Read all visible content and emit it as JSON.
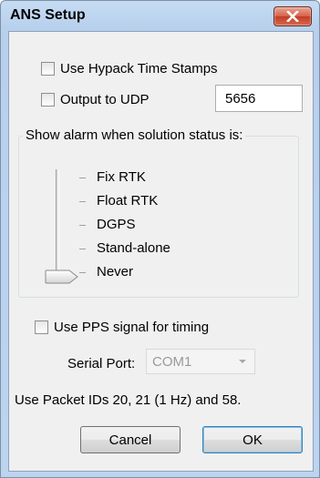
{
  "window": {
    "title": "ANS Setup"
  },
  "options": {
    "use_hypack_timestamps": {
      "label": "Use Hypack Time Stamps",
      "checked": false
    },
    "output_udp": {
      "label": "Output to UDP",
      "checked": false,
      "port": "5656"
    }
  },
  "alarm_group": {
    "label": "Show alarm when solution status is:",
    "levels": [
      "Fix RTK",
      "Float RTK",
      "DGPS",
      "Stand-alone",
      "Never"
    ],
    "selected": "Never"
  },
  "pps": {
    "label": "Use PPS signal for timing",
    "checked": false
  },
  "serial_port": {
    "label": "Serial Port:",
    "value": "COM1",
    "enabled": false
  },
  "info": {
    "text": "Use Packet IDs 20, 21 (1 Hz)  and 58."
  },
  "buttons": {
    "cancel": "Cancel",
    "ok": "OK"
  }
}
